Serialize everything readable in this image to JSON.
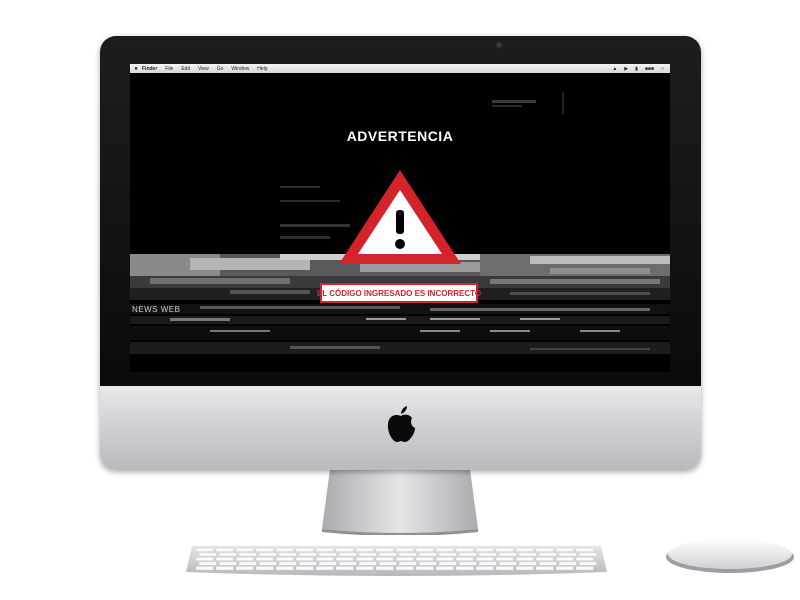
{
  "screen": {
    "menubar": {
      "app_name": "Finder",
      "items": [
        "File",
        "Edit",
        "View",
        "Go",
        "Window",
        "Help"
      ]
    },
    "warning": {
      "title": "ADVERTENCIA",
      "message": "EL CÓDIGO INGRESADO ES INCORRECTO",
      "icon": "warning-triangle-icon"
    },
    "background_word": "NEWS WEB"
  },
  "colors": {
    "alert_red": "#d3232b",
    "screen_bg": "#000000",
    "chin_silver": "#d6d8db"
  },
  "icons": {
    "apple_logo": "apple-logo-icon",
    "menu_apple": "apple-menu-icon",
    "webcam": "webcam-icon"
  }
}
